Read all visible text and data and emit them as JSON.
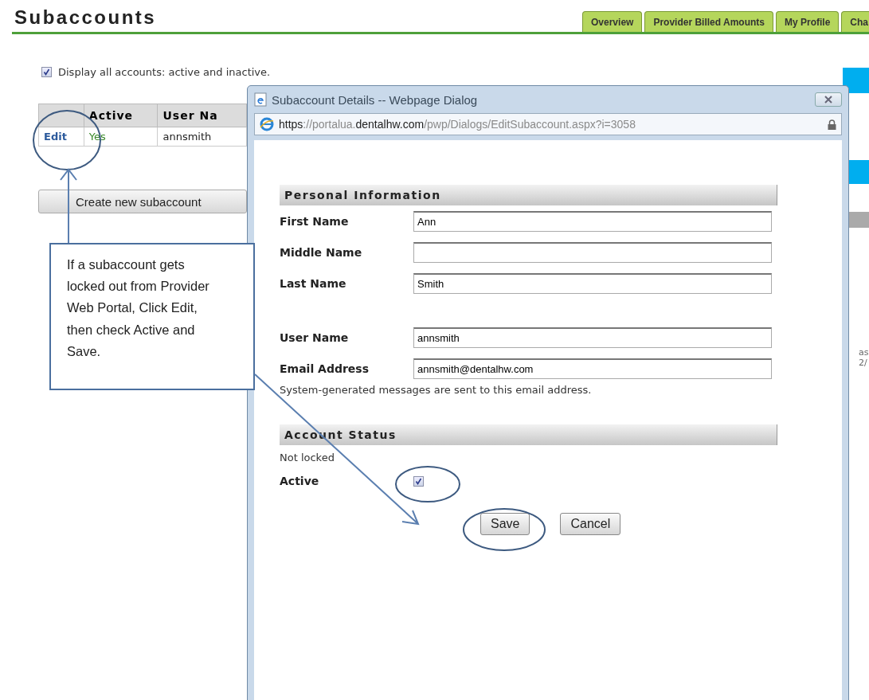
{
  "page": {
    "title": "Subaccounts",
    "tabs": [
      {
        "label": "Overview",
        "selected": false
      },
      {
        "label": "Provider Billed Amounts",
        "selected": false
      },
      {
        "label": "My Profile",
        "selected": false
      },
      {
        "label": "Cha",
        "selected": false
      }
    ],
    "display_all": {
      "label": "Display all accounts: active and inactive.",
      "checked": true
    },
    "table": {
      "columns": [
        "",
        "Active",
        "User Na"
      ],
      "rows": [
        {
          "cells": [
            "Edit",
            "Yes",
            "annsmith"
          ]
        }
      ]
    },
    "create_button": "Create new subaccount",
    "side_fragments": [
      "as",
      "2/"
    ]
  },
  "dialog": {
    "title": "Subaccount Details -- Webpage Dialog",
    "url": {
      "scheme": "https",
      "prefix": "://portalua.",
      "domain": "dentalhw.com",
      "path": "/pwp/Dialogs/EditSubaccount.aspx?i=3058"
    },
    "sections": [
      {
        "heading": "Personal Information",
        "items": [
          {
            "kind": "field",
            "label": "First Name",
            "value": "Ann"
          },
          {
            "kind": "field",
            "label": "Middle Name"
          },
          {
            "kind": "field",
            "label": "Last Name",
            "value": "Smith"
          },
          {
            "kind": "spacer"
          },
          {
            "kind": "field",
            "label": "User Name",
            "value": "annsmith"
          },
          {
            "kind": "field",
            "label": "Email Address",
            "value": "annsmith@dentalhw.com"
          },
          {
            "kind": "note",
            "text": "System-generated messages are sent to this email address."
          }
        ]
      },
      {
        "heading": "Account Status",
        "items": [
          {
            "kind": "note",
            "text": "Not locked"
          },
          {
            "kind": "checkbox",
            "label": "Active",
            "checked": true
          }
        ]
      }
    ],
    "buttons": [
      "Save",
      "Cancel"
    ]
  },
  "callout": {
    "text": "If a subaccount gets locked out from Provider Web Portal, Click Edit, then check Active and Save."
  }
}
